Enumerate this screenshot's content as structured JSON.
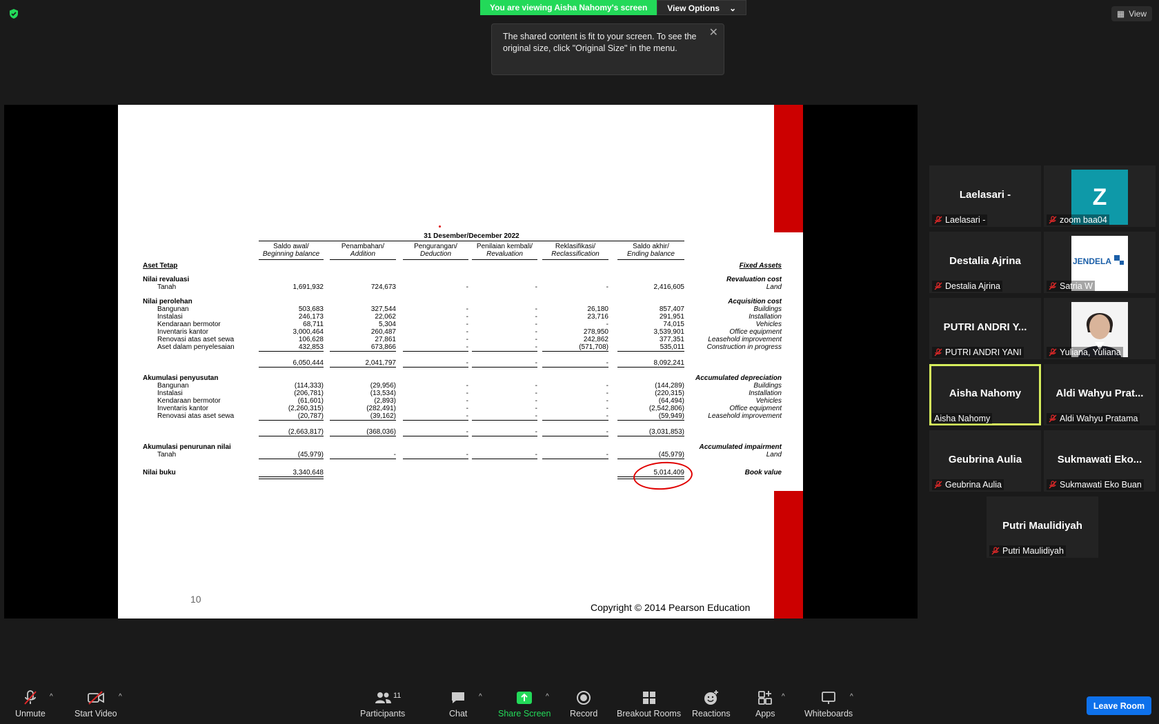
{
  "banner": {
    "viewing_text": "You are viewing Aisha Nahomy's screen",
    "view_options_label": "View Options"
  },
  "view_button_label": "View",
  "tooltip_text": "The shared content is fit to your screen. To see the original size, click \"Original Size\" in the menu.",
  "slide": {
    "page_number": "10",
    "copyright": "Copyright © 2014 Pearson Education",
    "period": "31 Desember/December 2022",
    "headers": [
      {
        "id": "Saldo awal/",
        "en": "Beginning balance"
      },
      {
        "id": "Penambahan/",
        "en": "Addition"
      },
      {
        "id": "Pengurangan/",
        "en": "Deduction"
      },
      {
        "id": "Penilaian kembali/",
        "en": "Revaluation"
      },
      {
        "id": "Reklasifikasi/",
        "en": "Reclassification"
      },
      {
        "id": "Saldo akhir/",
        "en": "Ending balance"
      }
    ],
    "left_title": "Aset Tetap",
    "right_title": "Fixed Assets",
    "rows": [
      {
        "label": "Nilai revaluasi",
        "right": "Revaluation cost",
        "bold": true,
        "values": []
      },
      {
        "label": "Tanah",
        "right": "Land",
        "indent": true,
        "values": [
          "1,691,932",
          "724,673",
          "-",
          "-",
          "-",
          "2,416,605"
        ]
      },
      {
        "label": "Nilai perolehan",
        "right": "Acquisition cost",
        "bold": true,
        "values": []
      },
      {
        "label": "Bangunan",
        "right": "Buildings",
        "indent": true,
        "values": [
          "503,683",
          "327,544",
          "-",
          "-",
          "26,180",
          "857,407"
        ]
      },
      {
        "label": "Instalasi",
        "right": "Installation",
        "indent": true,
        "values": [
          "246,173",
          "22,062",
          "-",
          "-",
          "23,716",
          "291,951"
        ]
      },
      {
        "label": "Kendaraan bermotor",
        "right": "Vehicles",
        "indent": true,
        "values": [
          "68,711",
          "5,304",
          "-",
          "-",
          "-",
          "74,015"
        ]
      },
      {
        "label": "Inventaris kantor",
        "right": "Office equipment",
        "indent": true,
        "values": [
          "3,000,464",
          "260,487",
          "-",
          "-",
          "278,950",
          "3,539,901"
        ]
      },
      {
        "label": "Renovasi atas aset sewa",
        "right": "Leasehold improvement",
        "indent": true,
        "values": [
          "106,628",
          "27,861",
          "-",
          "-",
          "242,862",
          "377,351"
        ]
      },
      {
        "label": "Aset dalam penyelesaian",
        "right": "Construction in progress",
        "indent": true,
        "values": [
          "432,853",
          "673,866",
          "-",
          "-",
          "(571,708)",
          "535,011"
        ]
      },
      {
        "label": "",
        "right": "",
        "values": [
          "6,050,444",
          "2,041,797",
          "-",
          "-",
          "-",
          "8,092,241"
        ]
      },
      {
        "label": "Akumulasi penyusutan",
        "right": "Accumulated depreciation",
        "bold": true,
        "values": []
      },
      {
        "label": "Bangunan",
        "right": "Buildings",
        "indent": true,
        "values": [
          "(114,333)",
          "(29,956)",
          "-",
          "-",
          "-",
          "(144,289)"
        ]
      },
      {
        "label": "Instalasi",
        "right": "Installation",
        "indent": true,
        "values": [
          "(206,781)",
          "(13,534)",
          "-",
          "-",
          "-",
          "(220,315)"
        ]
      },
      {
        "label": "Kendaraan bermotor",
        "right": "Vehicles",
        "indent": true,
        "values": [
          "(61,601)",
          "(2,893)",
          "-",
          "-",
          "-",
          "(64,494)"
        ]
      },
      {
        "label": "Inventaris kantor",
        "right": "Office equipment",
        "indent": true,
        "values": [
          "(2,260,315)",
          "(282,491)",
          "-",
          "-",
          "-",
          "(2,542,806)"
        ]
      },
      {
        "label": "Renovasi atas aset sewa",
        "right": "Leasehold improvement",
        "indent": true,
        "values": [
          "(20,787)",
          "(39,162)",
          "-",
          "-",
          "-",
          "(59,949)"
        ]
      },
      {
        "label": "",
        "right": "",
        "values": [
          "(2,663,817)",
          "(368,036)",
          "-",
          "-",
          "-",
          "(3,031,853)"
        ]
      },
      {
        "label": "Akumulasi penurunan nilai",
        "right": "Accumulated impairment",
        "bold": true,
        "values": []
      },
      {
        "label": "Tanah",
        "right": "Land",
        "indent": true,
        "values": [
          "(45,979)",
          "-",
          "-",
          "-",
          "-",
          "(45,979)"
        ]
      },
      {
        "label": "Nilai buku",
        "right": "Book value",
        "bold": true,
        "values": [
          "3,340,648",
          "",
          "",
          "",
          "",
          "5,014,409"
        ]
      }
    ]
  },
  "participants": [
    {
      "name": "Laelasari -",
      "label": "Laelasari -",
      "muted": true
    },
    {
      "name": "Z",
      "label": "zoom baa04",
      "muted": true
    },
    {
      "name": "Destalia Ajrina",
      "label": "Destalia Ajrina",
      "muted": true
    },
    {
      "name": "JENDELA",
      "label": "Satria W",
      "muted": true
    },
    {
      "name": "PUTRI ANDRI Y...",
      "label": "PUTRI ANDRI YANI",
      "muted": true
    },
    {
      "name": "",
      "label": "Yuliana, Yuliana",
      "muted": true
    },
    {
      "name": "Aisha Nahomy",
      "label": "Aisha Nahomy",
      "muted": false
    },
    {
      "name": "Aldi  Wahyu  Prat...",
      "label": "Aldi Wahyu Pratama",
      "muted": true
    },
    {
      "name": "Geubrina Aulia",
      "label": "Geubrina Aulia",
      "muted": true
    },
    {
      "name": "Sukmawati  Eko...",
      "label": "Sukmawati Eko Buan",
      "muted": true
    },
    {
      "name": "Putri Maulidiyah",
      "label": "Putri Maulidiyah",
      "muted": true
    }
  ],
  "toolbar": {
    "unmute": "Unmute",
    "start_video": "Start Video",
    "participants": "Participants",
    "participants_count": "11",
    "chat": "Chat",
    "share_screen": "Share Screen",
    "record": "Record",
    "breakout_rooms": "Breakout Rooms",
    "reactions": "Reactions",
    "apps": "Apps",
    "whiteboards": "Whiteboards",
    "leave_room": "Leave Room"
  },
  "colors": {
    "accent_green": "#23d959",
    "slide_red": "#cc0000",
    "active_speaker": "#d6ee5c",
    "leave_blue": "#0e71eb",
    "muted_red": "#e02828"
  }
}
